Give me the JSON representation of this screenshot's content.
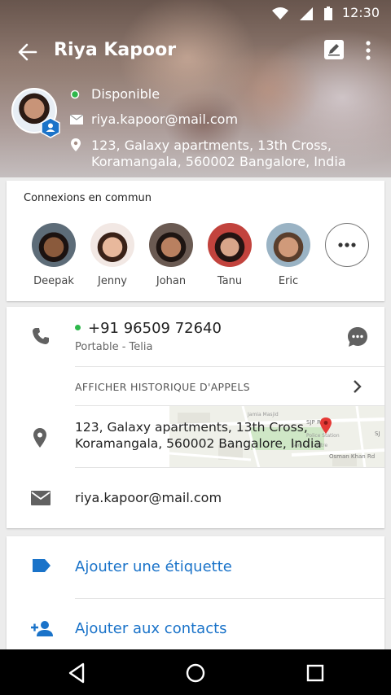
{
  "status_bar": {
    "time": "12:30"
  },
  "appbar": {
    "title": "Riya Kapoor"
  },
  "profile": {
    "status": "Disponible",
    "email": "riya.kapoor@mail.com",
    "address_line1": "123, Galaxy apartments, 13th Cross,",
    "address_line2": "Koramangala, 560002 Bangalore, India"
  },
  "connections": {
    "title": "Connexions en commun",
    "people": [
      {
        "name": "Deepak"
      },
      {
        "name": "Jenny"
      },
      {
        "name": "Johan"
      },
      {
        "name": "Tanu"
      },
      {
        "name": "Eric"
      }
    ]
  },
  "contact": {
    "phone_number": "+91 96509 72640",
    "phone_type": "Portable - Telia",
    "call_history": "AFFICHER HISTORIQUE D'APPELS",
    "address_line1": "123, Galaxy apartments, 13th Cross,",
    "address_line2": "Koramangala, 560002 Bangalore, India",
    "email": "riya.kapoor@mail.com"
  },
  "map_labels": {
    "road1": "SJP Road",
    "road2": "Osman Khan Rd",
    "place1": "Jamia Masjid",
    "place2": "Police Station",
    "place3": "Service Centre",
    "road3": "SJ"
  },
  "actions": {
    "add_label": "Ajouter une étiquette",
    "add_contact": "Ajouter aux contacts"
  },
  "colors": {
    "accent": "#1a73c9",
    "online": "#2eb84b",
    "pin": "#e53935"
  }
}
